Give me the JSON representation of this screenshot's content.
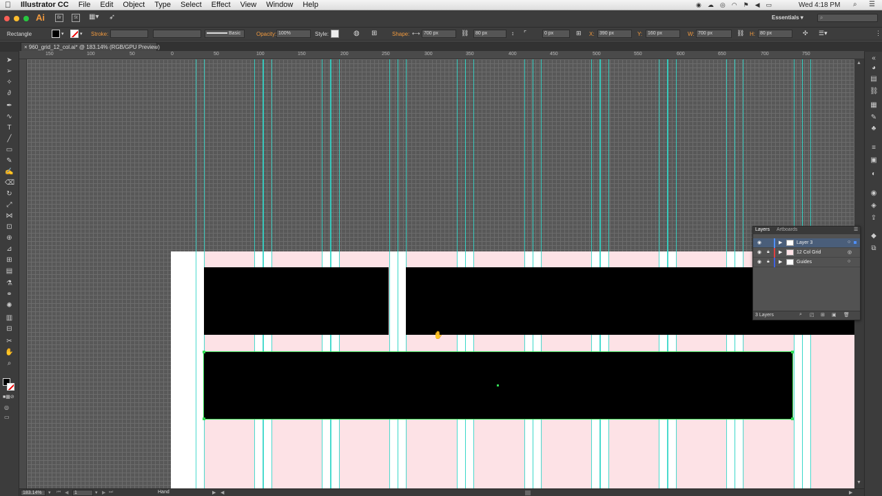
{
  "menubar": {
    "apple": "",
    "app_name": "Illustrator CC",
    "items": [
      "File",
      "Edit",
      "Object",
      "Type",
      "Select",
      "Effect",
      "View",
      "Window",
      "Help"
    ],
    "clock": "Wed 4:18 PM"
  },
  "appbar": {
    "logo": "Ai",
    "br": "Br",
    "st": "St",
    "workspace": "Essentials",
    "search_placeholder": ""
  },
  "control": {
    "object_type": "Rectangle",
    "stroke_label": "Stroke:",
    "brush_label": "Basic",
    "opacity_label": "Opacity:",
    "opacity_value": "100%",
    "style_label": "Style:",
    "shape_label": "Shape:",
    "shape_w": "700 px",
    "shape_h": "80 px",
    "corner": "0 px",
    "x_label": "X:",
    "x_value": "390 px",
    "y_label": "Y:",
    "y_value": "160 px",
    "w_label": "W:",
    "w_value": "700 px",
    "h_label": "H:",
    "h_value": "80 px"
  },
  "document": {
    "tab_title": "960_grid_12_col.ai* @ 183.14% (RGB/GPU Preview)"
  },
  "ruler": {
    "ticks": [
      "150",
      "100",
      "50",
      "0",
      "50",
      "100",
      "150",
      "200",
      "250",
      "300",
      "350",
      "400",
      "450",
      "500",
      "550",
      "600",
      "650",
      "700",
      "750"
    ]
  },
  "layers_panel": {
    "tabs": [
      "Layers",
      "Artboards"
    ],
    "layers": [
      {
        "name": "Layer 3",
        "color": "#4f8ff7",
        "selected": true
      },
      {
        "name": "12 Col Grid",
        "color": "#e04040",
        "selected": false
      },
      {
        "name": "Guides",
        "color": "#4060e0",
        "selected": false
      }
    ],
    "count_label": "3 Layers"
  },
  "status": {
    "zoom": "183.14%",
    "artboard": "1",
    "tool": "Hand"
  },
  "colors": {
    "guide": "#33d6c8",
    "column_pink": "#fde2e6",
    "selection": "#33dd55",
    "accent": "#f29a3e"
  }
}
